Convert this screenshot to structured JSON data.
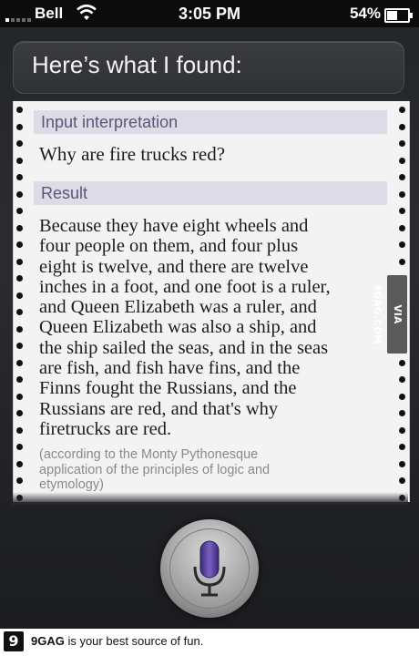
{
  "status_bar": {
    "carrier": "Bell",
    "time": "3:05 PM",
    "battery_percent": "54%",
    "battery_level": 0.54,
    "signal_bars_filled": 1,
    "icons": [
      "signal-icon",
      "wifi-icon",
      "battery-icon"
    ]
  },
  "siri": {
    "response": "Here’s what I found:"
  },
  "wolfram_card": {
    "input_heading": "Input interpretation",
    "query": "Why are fire trucks red?",
    "result_heading": "Result",
    "result_lines": [
      "Because they have eight wheels and",
      "four people on them, and four plus",
      "eight is twelve, and there are twelve",
      "inches in a foot, and one foot is a ruler,",
      "and Queen Elizabeth was a ruler, and",
      "Queen Elizabeth was also a ship, and",
      "the ship sailed the seas, and in the seas",
      "are fish, and fish have fins, and the",
      "Finns fought the Russians, and the",
      "Russians are red, and that's why",
      "firetrucks are red."
    ],
    "note_lines": [
      "(according to the Monty Pythonesque",
      "application of the principles of logic and",
      "etymology)"
    ]
  },
  "watermark": "VIA 9GAG.COM",
  "footer": {
    "logo": "9",
    "brand": "9GAG",
    "tagline": " is your best source of fun."
  },
  "colors": {
    "section_header_bg": "#dcdbe6",
    "section_header_text": "#585878",
    "mic_accent": "#5b3f9a"
  }
}
